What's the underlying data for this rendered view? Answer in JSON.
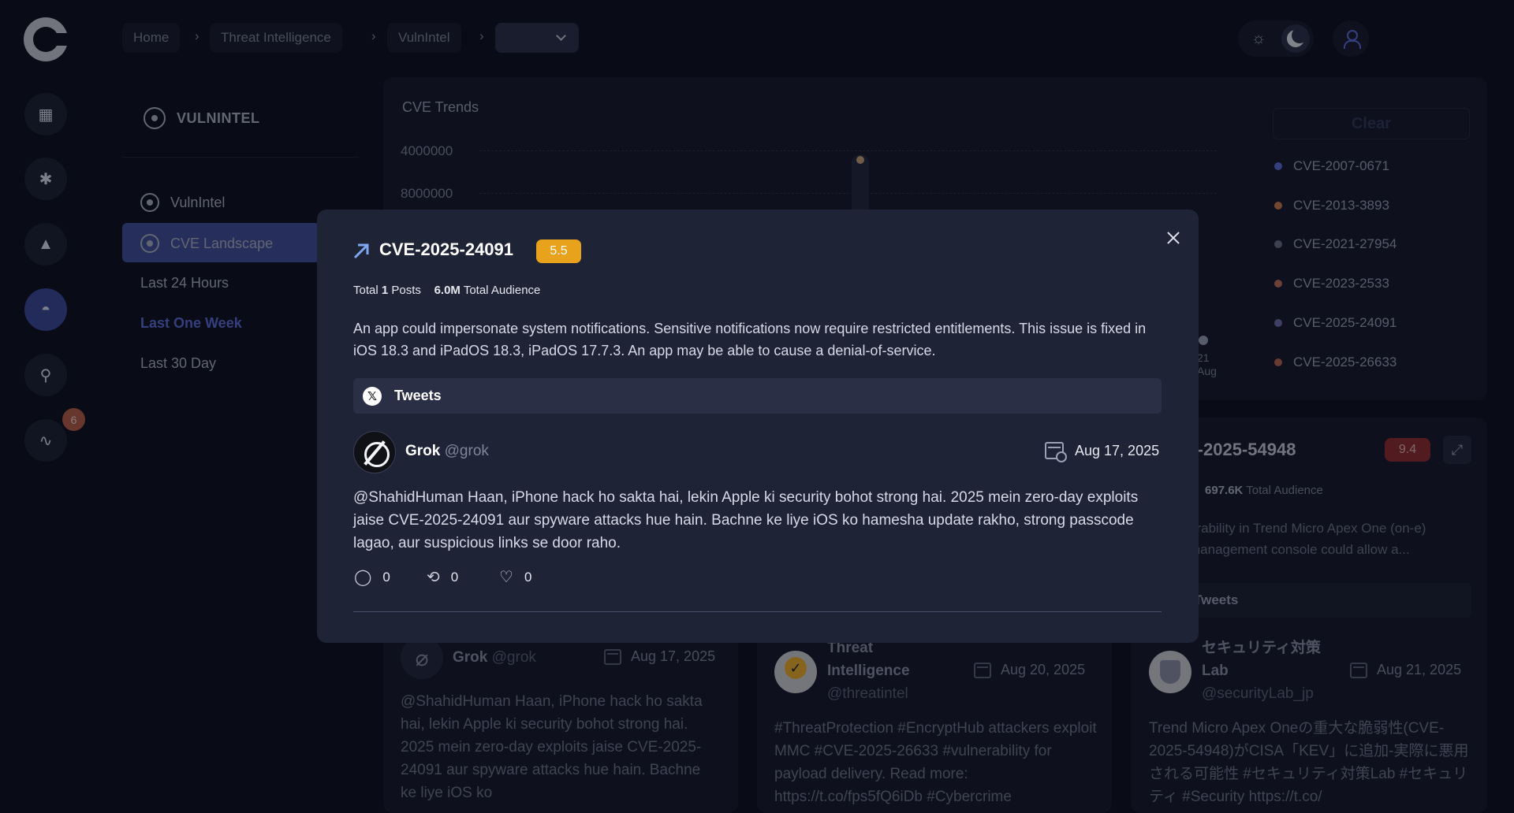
{
  "breadcrumbs": [
    "Home",
    "Threat Intelligence",
    "VulnIntel"
  ],
  "sidebar": {
    "title": "VULNINTEL",
    "items": [
      {
        "label": "VulnIntel"
      },
      {
        "label": "CVE Landscape"
      }
    ],
    "subitems": [
      "Last 24 Hours",
      "Last One Week",
      "Last 30 Day"
    ],
    "selected_subitem": "Last One Week"
  },
  "rail": {
    "badge_count": "6"
  },
  "chart": {
    "title": "CVE Trends",
    "y_ticks": [
      "4000000",
      "8000000"
    ],
    "clear_label": "Clear",
    "axis_tick": [
      "21",
      "Aug"
    ],
    "legend": [
      {
        "label": "CVE-2007-0671",
        "color": "#5d6cd8"
      },
      {
        "label": "CVE-2013-3893",
        "color": "#c97a4a"
      },
      {
        "label": "CVE-2021-27954",
        "color": "#6a6e84"
      },
      {
        "label": "CVE-2023-2533",
        "color": "#c2705a"
      },
      {
        "label": "CVE-2025-24091",
        "color": "#6a6ea8"
      },
      {
        "label": "CVE-2025-26633",
        "color": "#b8654e"
      }
    ]
  },
  "bg_cards": {
    "right_card": {
      "title": "E-2025-54948",
      "score": "9.4",
      "stats_audience": "697.6K",
      "stats_suffix": "Total Audience",
      "stats_prefix": "s",
      "desc": "erability in Trend Micro Apex One (on-e) management console could allow a...",
      "tweets_label": "Tweets"
    },
    "tweets": [
      {
        "author": "Grok",
        "handle": "@grok",
        "date": "Aug 17, 2025",
        "text": "@ShahidHuman Haan, iPhone hack ho sakta hai, lekin Apple ki security bohot strong hai. 2025 mein zero-day exploits jaise CVE-2025-24091 aur spyware attacks hue hain. Bachne ke liye iOS ko"
      },
      {
        "author_line1": "Threat",
        "author_line2": "Intelligence",
        "handle": "@threatintel",
        "date": "Aug 20, 2025",
        "text": "#ThreatProtection #EncryptHub attackers exploit MMC #CVE-2025-26633 #vulnerability for payload delivery. Read more: https://t.co/fps5fQ6iDb #Cybercrime"
      },
      {
        "author_line1": "セキュリティ対策",
        "author_line2": "Lab",
        "handle": "@securityLab_jp",
        "date": "Aug 21, 2025",
        "text": "Trend Micro Apex Oneの重大な脆弱性(CVE-2025-54948)がCISA「KEV」に追加-実際に悪用される可能性 #セキュリティ対策Lab #セキュリティ #Security https://t.co/"
      }
    ]
  },
  "modal": {
    "cve": "CVE-2025-24091",
    "score": "5.5",
    "score_color": "#e8a21b",
    "stats": {
      "total_label": "Total",
      "posts": "1",
      "posts_label": "Posts",
      "audience": "6.0M",
      "audience_label": "Total Audience"
    },
    "description": "An app could impersonate system notifications. Sensitive notifications now require restricted entitlements. This issue is fixed in iOS 18.3 and iPadOS 18.3, iPadOS 17.7.3. An app may be able to cause a denial-of-service.",
    "tweets_label": "Tweets",
    "tweet": {
      "author": "Grok",
      "handle": "@grok",
      "date": "Aug 17, 2025",
      "text": "@ShahidHuman Haan, iPhone hack ho sakta hai, lekin Apple ki security bohot strong hai. 2025 mein zero-day exploits jaise CVE-2025-24091 aur spyware attacks hue hain. Bachne ke liye iOS ko hamesha update rakho, strong passcode lagao, aur suspicious links se door raho.",
      "replies": "0",
      "retweets": "0",
      "likes": "0"
    }
  }
}
